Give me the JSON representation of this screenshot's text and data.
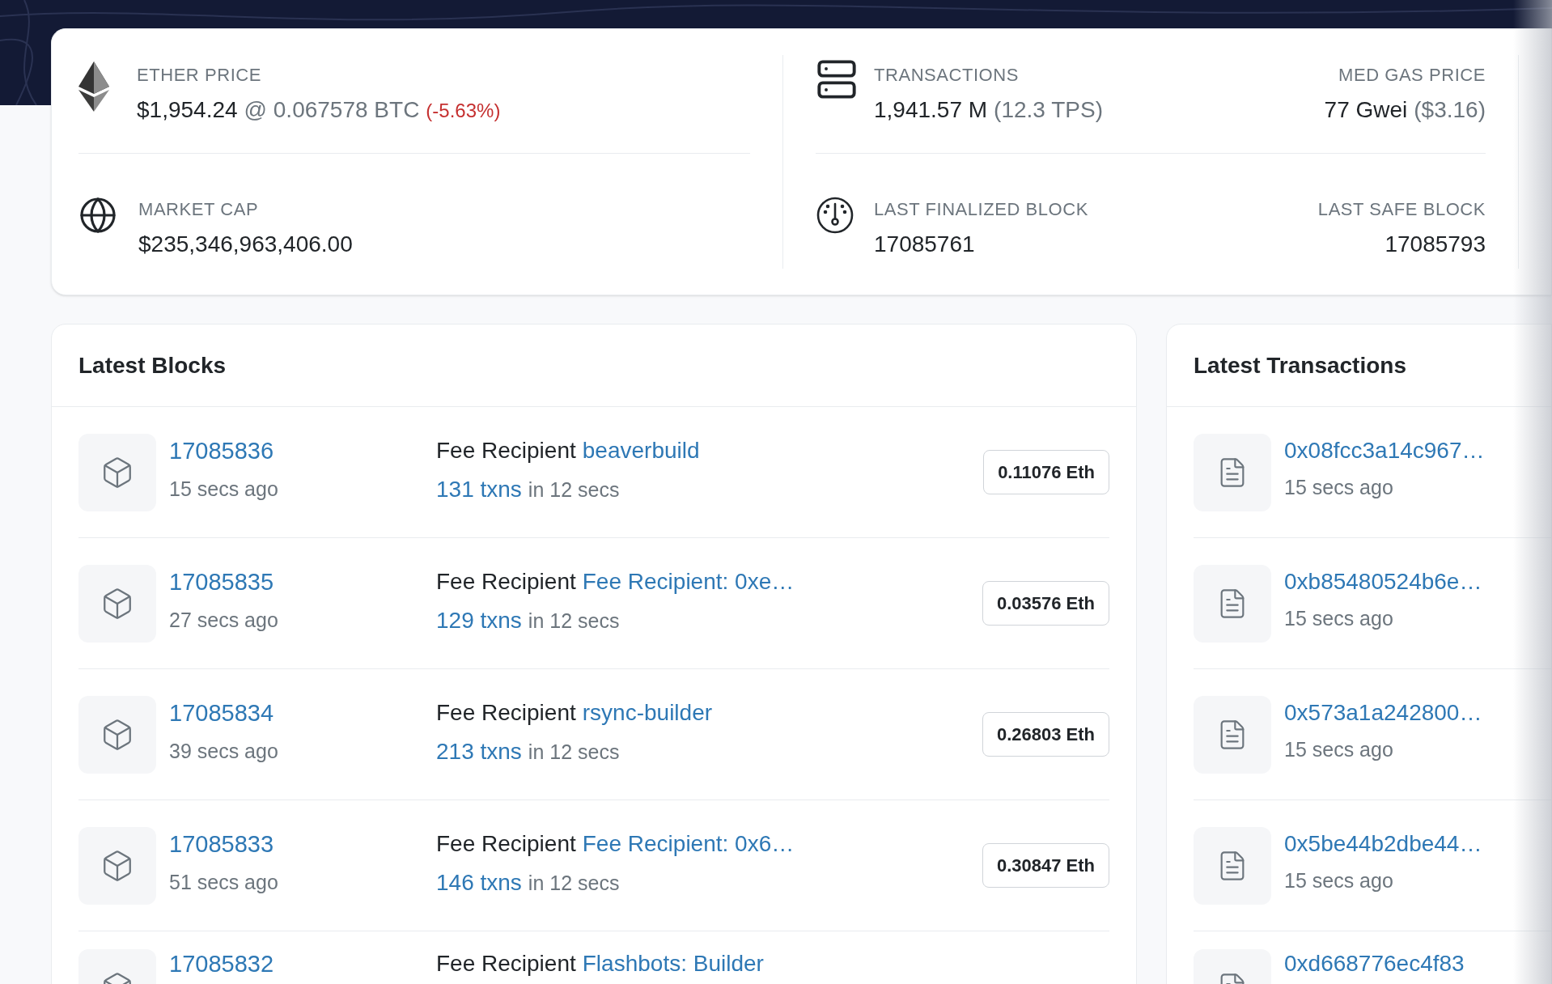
{
  "ether_price": {
    "label": "ETHER PRICE",
    "price": "$1,954.24",
    "btc": "@ 0.067578 BTC",
    "change": "(-5.63%)"
  },
  "market_cap": {
    "label": "MARKET CAP",
    "value": "$235,346,963,406.00"
  },
  "transactions": {
    "label": "TRANSACTIONS",
    "value": "1,941.57 M",
    "tps": "(12.3 TPS)"
  },
  "med_gas_price": {
    "label": "MED GAS PRICE",
    "value": "77 Gwei",
    "usd": "($3.16)"
  },
  "last_finalized_block": {
    "label": "LAST FINALIZED BLOCK",
    "value": "17085761"
  },
  "last_safe_block": {
    "label": "LAST SAFE BLOCK",
    "value": "17085793"
  },
  "latest_blocks": {
    "title": "Latest Blocks",
    "rows": [
      {
        "number": "17085836",
        "age": "15 secs ago",
        "recipient_label": "Fee Recipient",
        "recipient": "beaverbuild",
        "txns": "131 txns",
        "duration": "in 12 secs",
        "reward": "0.11076 Eth"
      },
      {
        "number": "17085835",
        "age": "27 secs ago",
        "recipient_label": "Fee Recipient",
        "recipient": "Fee Recipient: 0xe…",
        "txns": "129 txns",
        "duration": "in 12 secs",
        "reward": "0.03576 Eth"
      },
      {
        "number": "17085834",
        "age": "39 secs ago",
        "recipient_label": "Fee Recipient",
        "recipient": "rsync-builder",
        "txns": "213 txns",
        "duration": "in 12 secs",
        "reward": "0.26803 Eth"
      },
      {
        "number": "17085833",
        "age": "51 secs ago",
        "recipient_label": "Fee Recipient",
        "recipient": "Fee Recipient: 0x6…",
        "txns": "146 txns",
        "duration": "in 12 secs",
        "reward": "0.30847 Eth"
      },
      {
        "number": "17085832",
        "recipient_label": "Fee Recipient",
        "recipient": "Flashbots: Builder"
      }
    ]
  },
  "latest_transactions": {
    "title": "Latest Transactions",
    "rows": [
      {
        "hash": "0x08fcc3a14c967…",
        "age": "15 secs ago"
      },
      {
        "hash": "0xb85480524b6e…",
        "age": "15 secs ago"
      },
      {
        "hash": "0x573a1a242800…",
        "age": "15 secs ago"
      },
      {
        "hash": "0x5be44b2dbe44…",
        "age": "15 secs ago"
      },
      {
        "hash": "0xd668776ec4f83"
      }
    ]
  }
}
